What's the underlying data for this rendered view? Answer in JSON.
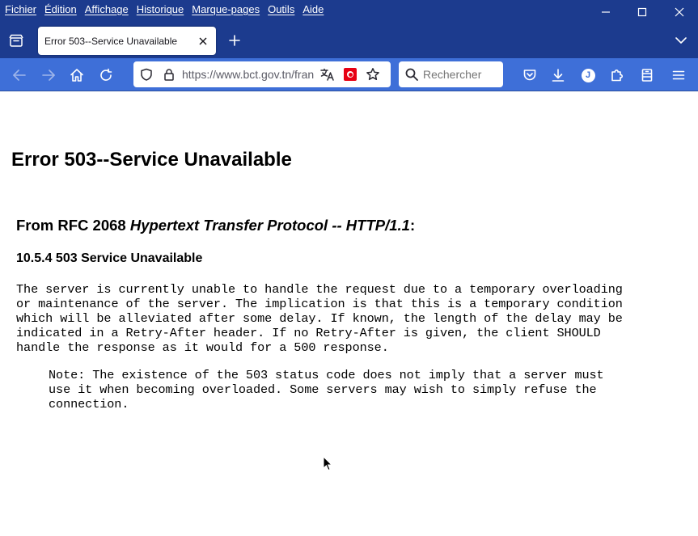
{
  "menubar": {
    "items": [
      "Fichier",
      "Édition",
      "Affichage",
      "Historique",
      "Marque-pages",
      "Outils",
      "Aide"
    ]
  },
  "window_controls": {
    "icons": [
      "minimize-icon",
      "maximize-icon",
      "close-icon"
    ]
  },
  "tabs": [
    {
      "title": "Error 503--Service Unavailable",
      "active": true
    }
  ],
  "toolbar": {
    "url": "https://www.bct.gov.tn/fran",
    "search_placeholder": "Rechercher",
    "avatar_initial": "J"
  },
  "page": {
    "title": "Error 503--Service Unavailable",
    "rfc_prefix": "From RFC 2068 ",
    "rfc_title": "Hypertext Transfer Protocol -- HTTP/1.1",
    "rfc_suffix": ":",
    "section_title": "10.5.4 503 Service Unavailable",
    "body": "The server is currently unable to handle the request due to a temporary overloading\nor maintenance of the server. The implication is that this is a temporary condition\nwhich will be alleviated after some delay. If known, the length of the delay may be\nindicated in a Retry-After header. If no Retry-After is given, the client SHOULD\nhandle the response as it would for a 500 response.",
    "note": "Note: The existence of the 503 status code does not imply that a server must\nuse it when becoming overloaded. Some servers may wish to simply refuse the\nconnection."
  },
  "colors": {
    "titlebar": "#1c3b8e",
    "toolbar": "#3e6fd8",
    "flag_red": "#e70013"
  }
}
